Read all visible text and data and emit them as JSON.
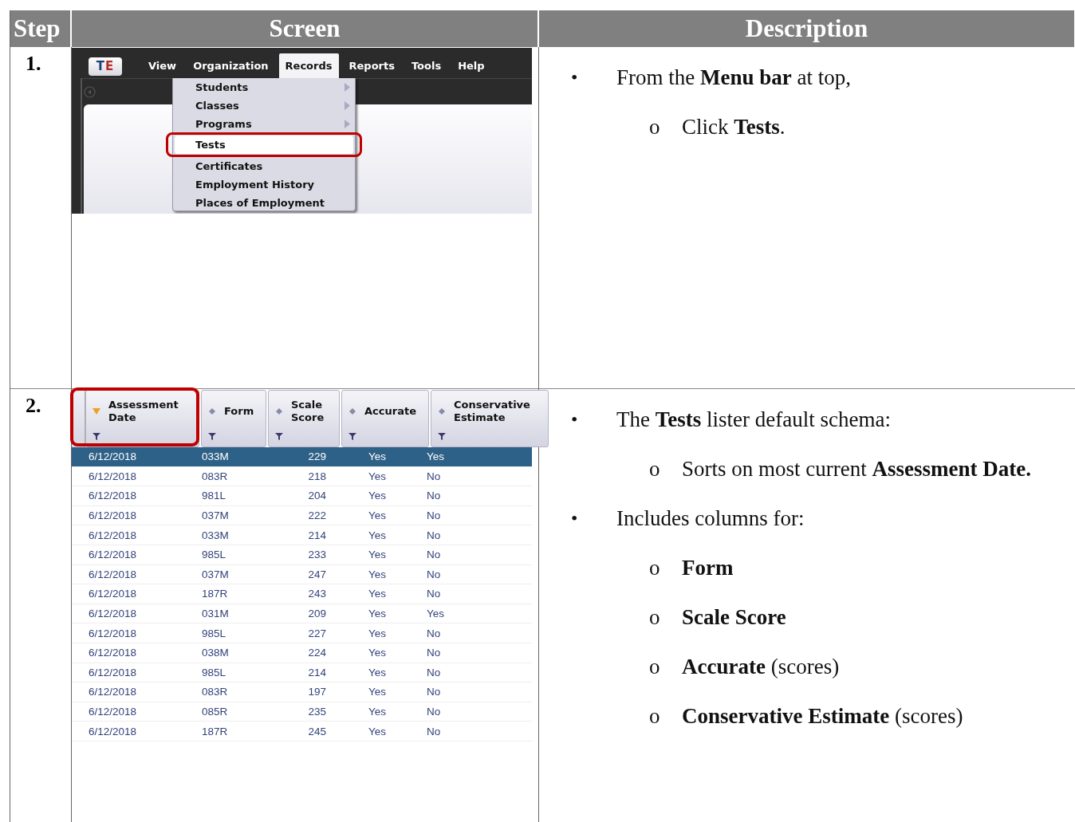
{
  "table": {
    "columns": [
      "Step",
      "Screen",
      "Description"
    ],
    "rows": [
      {
        "step": "1.",
        "screen": {
          "kind": "menu",
          "logo": "TE",
          "menus": [
            {
              "label": "View",
              "selected": false
            },
            {
              "label": "Organization",
              "selected": false
            },
            {
              "label": "Records",
              "selected": true
            },
            {
              "label": "Reports",
              "selected": false
            },
            {
              "label": "Tools",
              "selected": false
            },
            {
              "label": "Help",
              "selected": false
            }
          ],
          "dropdown": [
            {
              "label": "Students",
              "submenu": true,
              "selected": false,
              "outlined": false
            },
            {
              "label": "Classes",
              "submenu": true,
              "selected": false,
              "outlined": false
            },
            {
              "label": "Programs",
              "submenu": true,
              "selected": false,
              "outlined": false
            },
            {
              "label": "Tests",
              "submenu": false,
              "selected": true,
              "outlined": true
            },
            {
              "label": "Certificates",
              "submenu": false,
              "selected": false,
              "outlined": false
            },
            {
              "label": "Employment History",
              "submenu": false,
              "selected": false,
              "outlined": false
            },
            {
              "label": "Places of Employment",
              "submenu": false,
              "selected": false,
              "outlined": false
            }
          ]
        },
        "description": [
          {
            "kind": "bullet",
            "marker": "•",
            "text": "From the **Menu bar** at top,"
          },
          {
            "kind": "sub",
            "marker": "o",
            "text": "Click **Tests**."
          }
        ]
      },
      {
        "step": "2.",
        "screen": {
          "kind": "lister",
          "columns": [
            {
              "label": "Assessment Date",
              "sorted": true,
              "outlined": true
            },
            {
              "label": "Form",
              "sorted": false,
              "outlined": false
            },
            {
              "label": "Scale Score",
              "sorted": false,
              "outlined": false
            },
            {
              "label": "Accurate",
              "sorted": false,
              "outlined": false
            },
            {
              "label": "Conservative Estimate",
              "sorted": false,
              "outlined": false
            }
          ],
          "rows": [
            {
              "cells": [
                "6/12/2018",
                "033M",
                "229",
                "Yes",
                "Yes"
              ],
              "selected": true
            },
            {
              "cells": [
                "6/12/2018",
                "083R",
                "218",
                "Yes",
                "No"
              ],
              "selected": false
            },
            {
              "cells": [
                "6/12/2018",
                "981L",
                "204",
                "Yes",
                "No"
              ],
              "selected": false
            },
            {
              "cells": [
                "6/12/2018",
                "037M",
                "222",
                "Yes",
                "No"
              ],
              "selected": false
            },
            {
              "cells": [
                "6/12/2018",
                "033M",
                "214",
                "Yes",
                "No"
              ],
              "selected": false
            },
            {
              "cells": [
                "6/12/2018",
                "985L",
                "233",
                "Yes",
                "No"
              ],
              "selected": false
            },
            {
              "cells": [
                "6/12/2018",
                "037M",
                "247",
                "Yes",
                "No"
              ],
              "selected": false
            },
            {
              "cells": [
                "6/12/2018",
                "187R",
                "243",
                "Yes",
                "No"
              ],
              "selected": false
            },
            {
              "cells": [
                "6/12/2018",
                "031M",
                "209",
                "Yes",
                "Yes"
              ],
              "selected": false
            },
            {
              "cells": [
                "6/12/2018",
                "985L",
                "227",
                "Yes",
                "No"
              ],
              "selected": false
            },
            {
              "cells": [
                "6/12/2018",
                "038M",
                "224",
                "Yes",
                "No"
              ],
              "selected": false
            },
            {
              "cells": [
                "6/12/2018",
                "985L",
                "214",
                "Yes",
                "No"
              ],
              "selected": false
            },
            {
              "cells": [
                "6/12/2018",
                "083R",
                "197",
                "Yes",
                "No"
              ],
              "selected": false
            },
            {
              "cells": [
                "6/12/2018",
                "085R",
                "235",
                "Yes",
                "No"
              ],
              "selected": false
            },
            {
              "cells": [
                "6/12/2018",
                "187R",
                "245",
                "Yes",
                "No"
              ],
              "selected": false
            }
          ]
        },
        "description": [
          {
            "kind": "bullet",
            "marker": "•",
            "text": "The **Tests** lister default schema:"
          },
          {
            "kind": "sub",
            "marker": "o",
            "text": "Sorts on most current **Assessment Date.**"
          },
          {
            "kind": "bullet",
            "marker": "•",
            "text": "Includes columns for:"
          },
          {
            "kind": "sub",
            "marker": "o",
            "text": "**Form**"
          },
          {
            "kind": "sub",
            "marker": "o",
            "text": "**Scale Score**"
          },
          {
            "kind": "sub",
            "marker": "o",
            "text": "**Accurate** (scores)"
          },
          {
            "kind": "sub",
            "marker": "o",
            "text": "**Conservative Estimate** (scores)"
          }
        ]
      }
    ]
  }
}
